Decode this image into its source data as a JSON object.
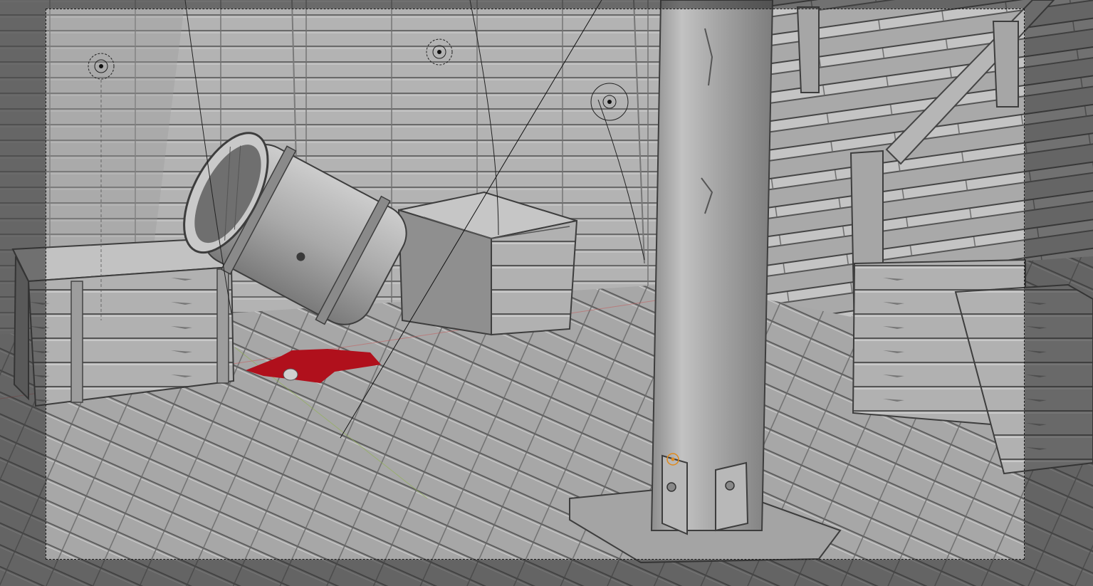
{
  "viewport": {
    "mode": "camera-view",
    "shading": "solid",
    "objects": [
      "barrel",
      "crate-left",
      "crate-middle",
      "crate-right",
      "support-pillar",
      "staircase",
      "floor-planks",
      "wall-planks",
      "light-left",
      "light-center",
      "light-right",
      "camera-target",
      "red-marker"
    ],
    "colors": {
      "background": "#8a8a8a",
      "passepartout": "#2e2e2e",
      "wood_light": "#b9b9b9",
      "wood_mid": "#9c9c9c",
      "wood_dark": "#6e6e6e",
      "outline": "#3d3d3d",
      "marker_red": "#b0101c",
      "target_orange": "#e08a1c",
      "axis_x": "#c55b5b",
      "axis_y": "#8fb34a"
    }
  }
}
